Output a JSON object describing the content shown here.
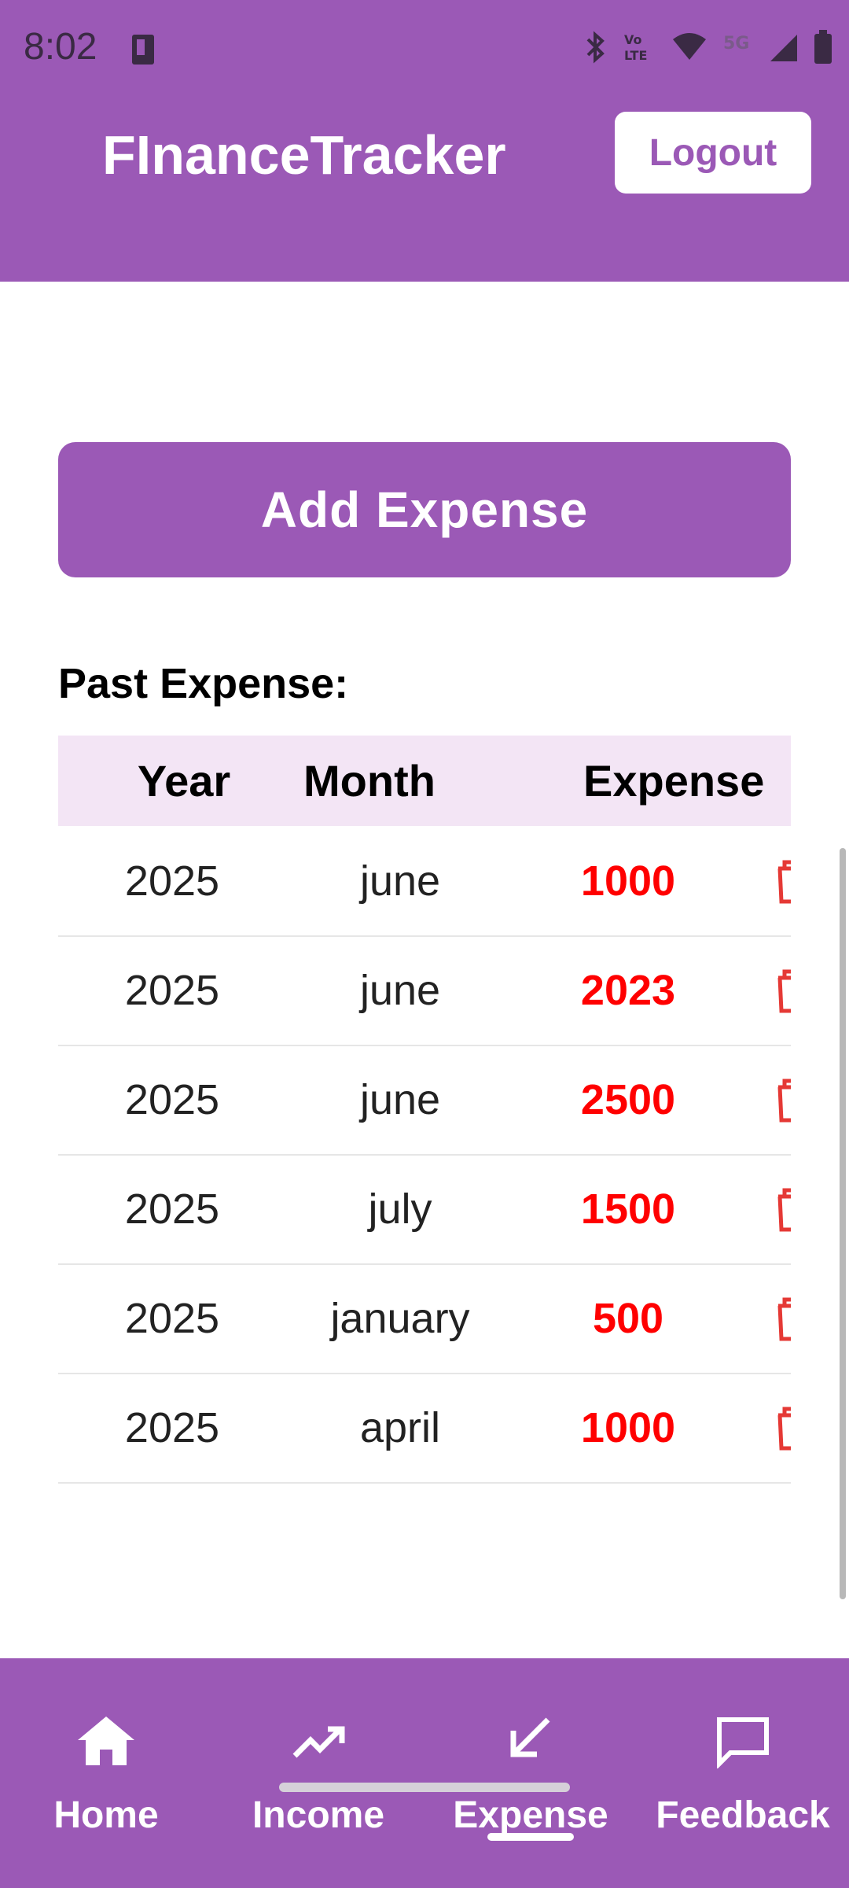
{
  "status_bar": {
    "time": "8:02",
    "icons": [
      "sim-card-icon",
      "bluetooth-icon",
      "volte-icon",
      "wifi-icon",
      "5g-icon",
      "signal-icon",
      "battery-icon"
    ]
  },
  "app_bar": {
    "title": "FInanceTracker",
    "logout_label": "Logout"
  },
  "actions": {
    "add_expense_label": "Add Expense"
  },
  "past_expense": {
    "title": "Past Expense:",
    "columns": [
      "Year",
      "Month",
      "Expense"
    ],
    "rows": [
      {
        "year": "2025",
        "month": "june",
        "expense": "1000"
      },
      {
        "year": "2025",
        "month": "june",
        "expense": "2023"
      },
      {
        "year": "2025",
        "month": "june",
        "expense": "2500"
      },
      {
        "year": "2025",
        "month": "july",
        "expense": "1500"
      },
      {
        "year": "2025",
        "month": "january",
        "expense": "500"
      },
      {
        "year": "2025",
        "month": "april",
        "expense": "1000"
      }
    ]
  },
  "bottom_nav": {
    "items": [
      {
        "label": "Home",
        "icon": "home-icon"
      },
      {
        "label": "Income",
        "icon": "trending-up-icon"
      },
      {
        "label": "Expense",
        "icon": "arrow-down-left-icon"
      },
      {
        "label": "Feedback",
        "icon": "chat-bubble-icon"
      }
    ],
    "active": "Expense"
  },
  "colors": {
    "primary": "#9B59B6",
    "header_row": "#F3E5F5",
    "amount": "#FF0000",
    "trash": "#E53935"
  }
}
